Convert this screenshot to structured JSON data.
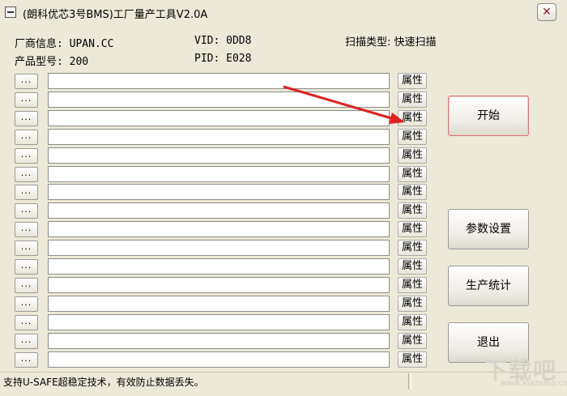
{
  "window": {
    "title": "(朗科优芯3号BMS)工厂量产工具V2.0A",
    "close_glyph": "✕"
  },
  "info": {
    "vendor": "厂商信息: UPAN.CC",
    "model": "产品型号: 200",
    "vid": "VID: 0DD8",
    "pid": "PID: E028",
    "scan_type": "扫描类型: 快速扫描"
  },
  "rows": {
    "browse_label": "...",
    "prop_label": "属性",
    "count": 16
  },
  "buttons": {
    "start": "开始",
    "settings": "参数设置",
    "stats": "生产统计",
    "exit": "退出"
  },
  "status": {
    "text": "支持U-SAFE超稳定技术，有效防止数据丢失。"
  },
  "watermark": {
    "brand": "下载吧",
    "url": "www.xiazaiba.com"
  },
  "colors": {
    "window_bg": "#ece9d8",
    "arrow": "#dd2222"
  }
}
